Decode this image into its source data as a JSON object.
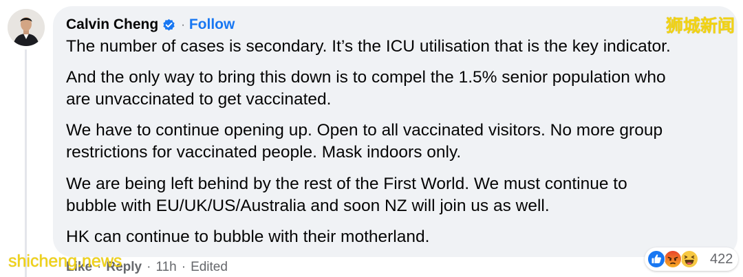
{
  "comment": {
    "author": "Calvin Cheng",
    "dot": "·",
    "follow_label": "Follow",
    "paragraphs": [
      {
        "lines": [
          "The number of cases is secondary. It’s the ICU utilisation that is the key indicator."
        ]
      },
      {
        "lines": [
          "And the only way to bring this down is to compel the 1.5% senior population who",
          "are unvaccinated to get vaccinated."
        ]
      },
      {
        "lines": [
          "We have to continue opening up. Open to all vaccinated visitors. No more group",
          "restrictions for vaccinated people. Mask indoors only."
        ]
      },
      {
        "lines": [
          "We are being left behind by the rest of the First World. We must continue to",
          "bubble with EU/UK/US/Australia and soon NZ will join us as well."
        ]
      },
      {
        "lines": [
          "HK can continue to bubble with their motherland."
        ]
      }
    ],
    "actions": {
      "like": "Like",
      "reply": "Reply",
      "sep": "·",
      "time": "11h",
      "edited": "Edited"
    },
    "reactions": {
      "icons": [
        "like-icon",
        "angry-icon",
        "haha-icon"
      ],
      "count": "422"
    }
  },
  "watermarks": {
    "top_right": "狮城新闻",
    "bottom_left": "shicheng.news"
  },
  "colors": {
    "bubble": "#f0f2f5",
    "link_blue": "#1877f2",
    "secondary_text": "#65676b",
    "watermark": "#f2d313"
  }
}
